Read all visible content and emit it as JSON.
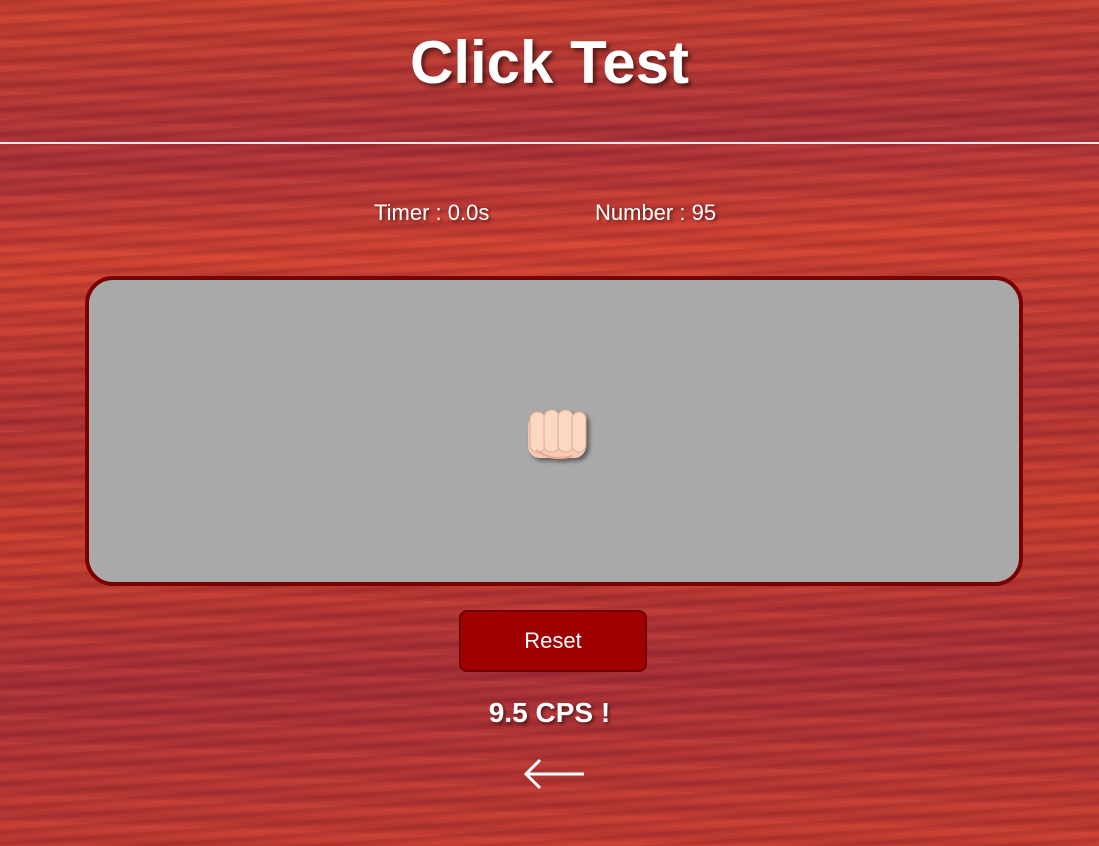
{
  "header": {
    "title": "Click Test"
  },
  "stats": {
    "timer": "Timer : 0.0s",
    "number": "Number : 95"
  },
  "click_area": {
    "icon": "fist-icon"
  },
  "reset_button": {
    "label": "Reset"
  },
  "result": {
    "cps": "9.5 CPS !"
  },
  "navigation": {
    "back_icon": "left-arrow-icon"
  },
  "colors": {
    "background": "#c23a2e",
    "click_area": "#a9a9a9",
    "click_area_border": "#7a0000",
    "button": "#a00000",
    "text": "#ffffff"
  }
}
